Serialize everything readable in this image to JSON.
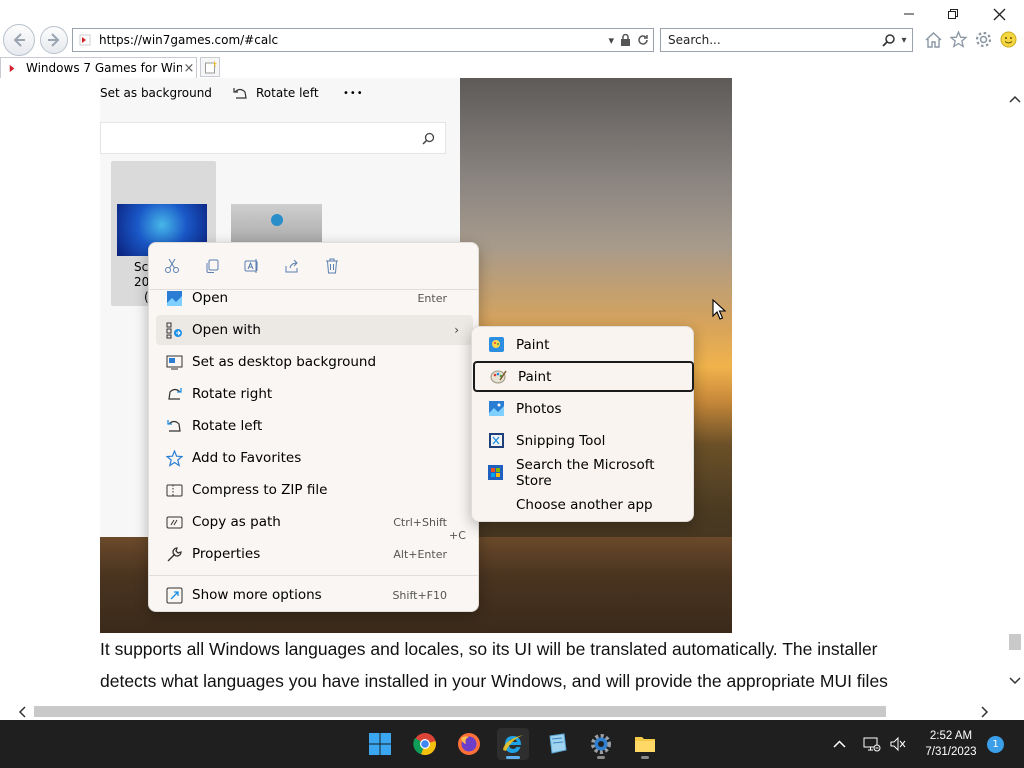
{
  "browser": {
    "url": "https://win7games.com/#calc",
    "search_placeholder": "Search...",
    "tab_title": "Windows 7 Games for Wind...",
    "tab_close": "×"
  },
  "explorer": {
    "toolbar": {
      "set_bg": "Set as background",
      "rotate_left": "Rotate left",
      "more": "•••"
    },
    "file_name_lines": [
      "Scr",
      "202",
      "("
    ]
  },
  "page": {
    "paragraph_line1": "It supports all Windows languages and locales, so its UI will be translated automatically. The installer",
    "paragraph_line2": "detects what languages you have installed in your Windows, and will provide the appropriate MUI files"
  },
  "context_menu": {
    "items": [
      {
        "label": "Open",
        "shortcut": "Enter",
        "icon": "open-icon"
      },
      {
        "label": "Open with",
        "shortcut": "",
        "icon": "open-with-icon"
      },
      {
        "label": "Set as desktop background",
        "shortcut": "",
        "icon": "desktop-background-icon"
      },
      {
        "label": "Rotate right",
        "shortcut": "",
        "icon": "rotate-right-icon"
      },
      {
        "label": "Rotate left",
        "shortcut": "",
        "icon": "rotate-left-icon"
      },
      {
        "label": "Add to Favorites",
        "shortcut": "",
        "icon": "star-icon"
      },
      {
        "label": "Compress to ZIP file",
        "shortcut": "",
        "icon": "zip-icon"
      },
      {
        "label": "Copy as path",
        "shortcut": "Ctrl+Shift",
        "icon": "copy-path-icon"
      },
      {
        "label": "Properties",
        "shortcut": "Alt+Enter",
        "icon": "properties-icon"
      },
      {
        "label": "Show more options",
        "shortcut": "Shift+F10",
        "icon": "more-options-icon"
      }
    ],
    "copy_path_shortcut_2": "+C",
    "submenu_arrow": "›"
  },
  "open_with_menu": {
    "items": [
      {
        "label": "Paint",
        "icon": "paint-icon"
      },
      {
        "label": "Paint",
        "icon": "paint-classic-icon"
      },
      {
        "label": "Photos",
        "icon": "photos-icon"
      },
      {
        "label": "Snipping Tool",
        "icon": "snipping-tool-icon"
      },
      {
        "label": "Search the Microsoft Store",
        "icon": "store-icon"
      },
      {
        "label": "Choose another app",
        "icon": ""
      }
    ]
  },
  "taskbar": {
    "time": "2:52 AM",
    "date": "7/31/2023",
    "notification_count": "1"
  },
  "colors": {
    "accent": "#1b8ee6",
    "taskbar_bg": "#1f1f1f",
    "menu_bg": "#f9f6f3"
  }
}
